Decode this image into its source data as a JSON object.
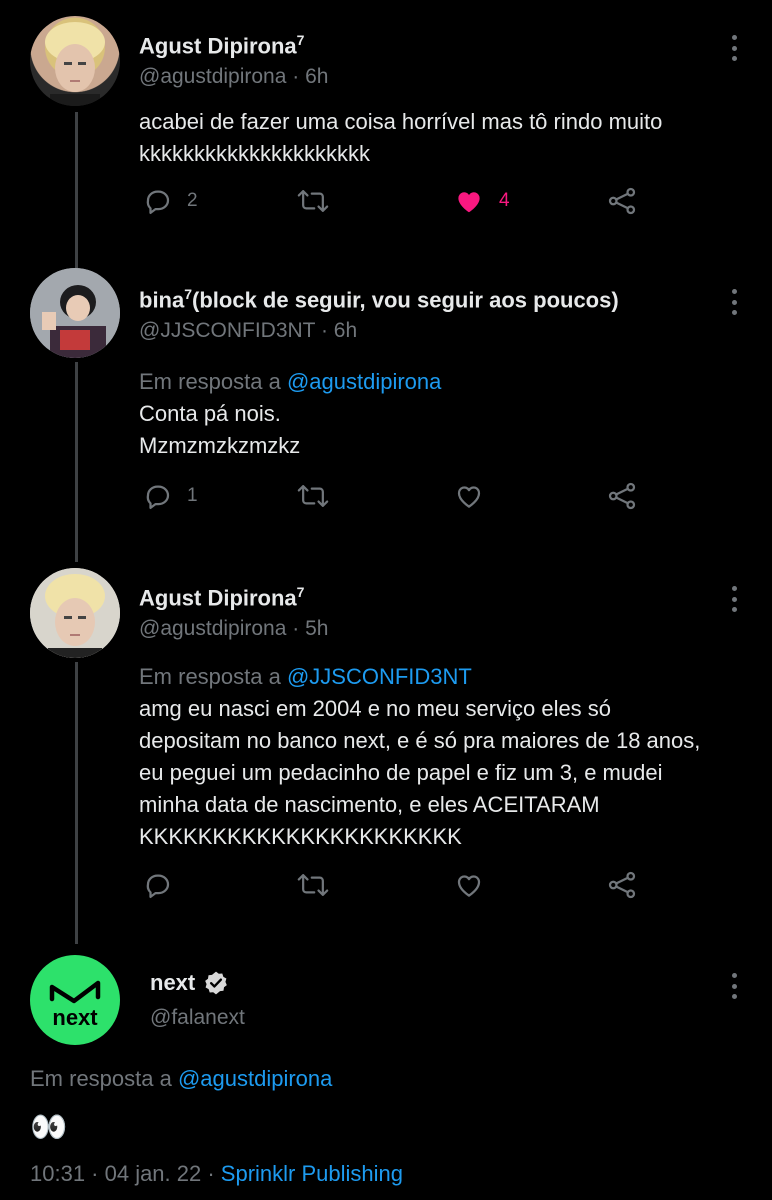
{
  "tweets": [
    {
      "name": "Agust Dipirona",
      "name_sup": "7",
      "handle_time": "@agustdipirona · 6h",
      "reply_prefix": "",
      "reply_mention": "",
      "lines": [
        "acabei de fazer uma coisa horrível mas tô rindo muito",
        "kkkkkkkkkkkkkkkkkkkkk"
      ],
      "reply_count": "2",
      "retweet_count": "",
      "like_count": "4",
      "liked": true
    },
    {
      "name": "bina",
      "name_sup": "7",
      "name_suffix": "(block de seguir, vou seguir aos poucos)",
      "handle_time": "@JJSCONFID3NT · 6h",
      "reply_prefix": "Em resposta a ",
      "reply_mention": "@agustdipirona",
      "lines": [
        "Conta pá nois.",
        "Mzmzmzkzmzkz"
      ],
      "reply_count": "1",
      "retweet_count": "",
      "like_count": "",
      "liked": false
    },
    {
      "name": "Agust Dipirona",
      "name_sup": "7",
      "handle_time": "@agustdipirona · 5h",
      "reply_prefix": "Em resposta a ",
      "reply_mention": "@JJSCONFID3NT",
      "lines": [
        "amg eu nasci em 2004 e no meu serviço eles só",
        "depositam no banco next, e é só pra maiores de 18 anos,",
        "eu peguei um pedacinho de papel e fiz um 3, e mudei",
        "minha data de nascimento, e eles ACEITARAM",
        "KKKKKKKKKKKKKKKKKKKKKK"
      ],
      "reply_count": "",
      "retweet_count": "",
      "like_count": "",
      "liked": false
    }
  ],
  "main_tweet": {
    "avatar_label": "next",
    "name": "next",
    "handle": "@falanext",
    "reply_prefix": "Em resposta a ",
    "reply_mention": "@agustdipirona",
    "text": "👀",
    "time_date": "10:31 · 04 jan. 22 · ",
    "source": "Sprinklr Publishing"
  },
  "icons": {
    "reply": "reply-icon",
    "retweet": "retweet-icon",
    "like": "heart-icon",
    "share": "share-icon",
    "more": "more-options-icon",
    "verified": "verified-badge-icon"
  },
  "colors": {
    "background": "#000000",
    "text": "#e7e9ea",
    "muted": "#71767b",
    "link": "#1d9bf0",
    "like": "#f91880",
    "brand": "#2de16b"
  }
}
